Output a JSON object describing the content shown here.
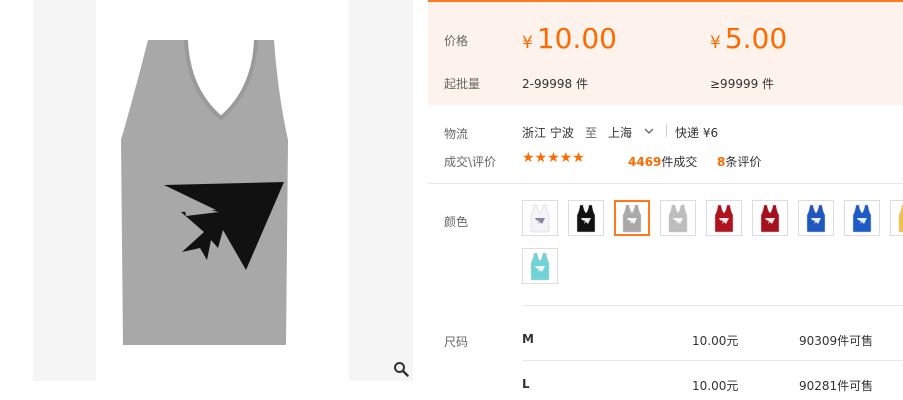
{
  "gallery": {
    "zoom_icon": "magnifier-icon",
    "product_colors": {
      "shirt": "#a8a8a8",
      "logo": "#111111"
    }
  },
  "pricing": {
    "price_label": "价格",
    "moq_label": "起批量",
    "currency": "¥",
    "tiers": [
      {
        "price": "10.00",
        "range": "2-99998 件"
      },
      {
        "price": "5.00",
        "range": "≥99999 件"
      }
    ],
    "accent": "#ff6a00"
  },
  "logistics": {
    "label": "物流",
    "origin": "浙江 宁波",
    "to_word": "至",
    "destination": "上海",
    "express": "快递 ¥6"
  },
  "deals": {
    "label": "成交\\评价",
    "stars": "★★★★★",
    "deal_count": "4469",
    "deal_suffix": "件成交",
    "review_count": "8",
    "review_suffix": "条评价"
  },
  "colors": {
    "label": "颜色",
    "swatches": [
      {
        "color": "#f4f4f8",
        "selected": false
      },
      {
        "color": "#111111",
        "selected": false
      },
      {
        "color": "#a9a9a9",
        "selected": true
      },
      {
        "color": "#bdbdbd",
        "selected": false
      },
      {
        "color": "#b0121e",
        "selected": false
      },
      {
        "color": "#a5101d",
        "selected": false
      },
      {
        "color": "#1f57c2",
        "selected": false
      },
      {
        "color": "#1d5cc8",
        "selected": false
      },
      {
        "color": "#f0c24a",
        "selected": false
      },
      {
        "color": "#6fd3d8",
        "selected": false
      }
    ]
  },
  "sizes": {
    "label": "尺码",
    "rows": [
      {
        "size": "M",
        "price": "10.00元",
        "stock": "90309件可售"
      },
      {
        "size": "L",
        "price": "10.00元",
        "stock": "90281件可售"
      }
    ]
  }
}
